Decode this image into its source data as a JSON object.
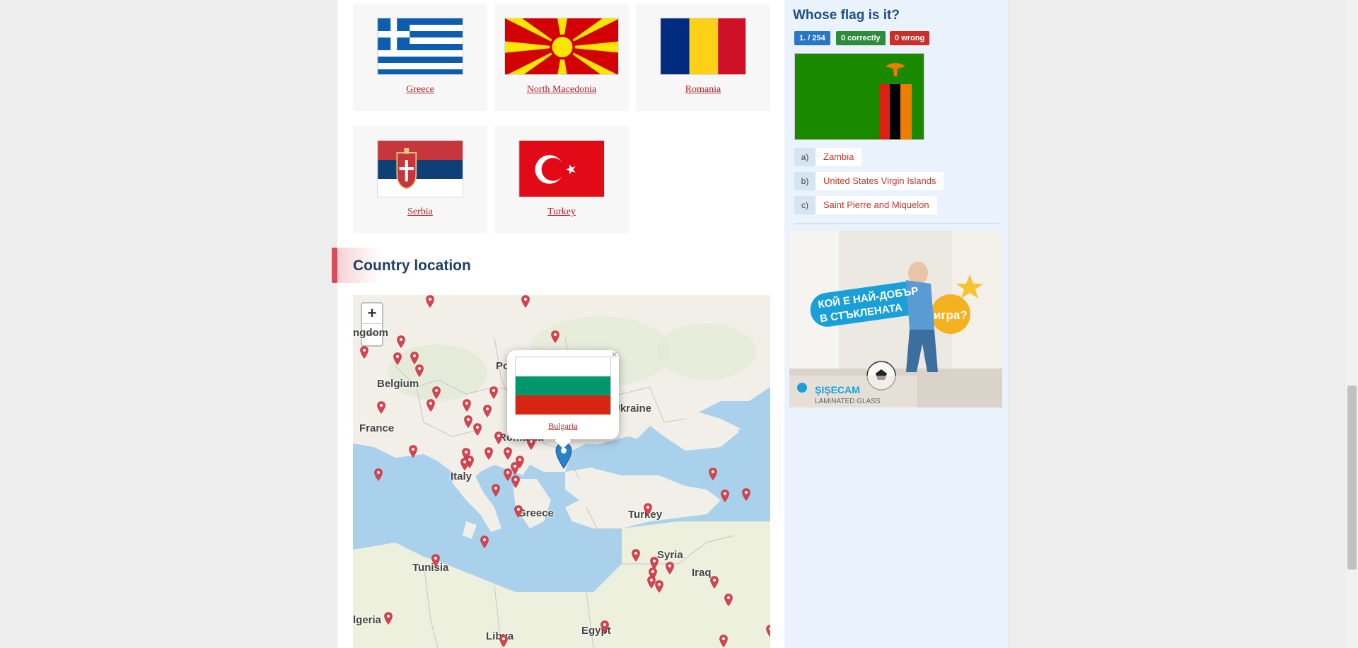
{
  "flags": [
    {
      "name": "Greece"
    },
    {
      "name": "North Macedonia"
    },
    {
      "name": "Romania"
    },
    {
      "name": "Serbia"
    },
    {
      "name": "Turkey"
    }
  ],
  "section": {
    "title": "Country location"
  },
  "map": {
    "zoom_in": "+",
    "zoom_out": "−",
    "labels": [
      "ngdom",
      "Belgium",
      "Po",
      "Ukraine",
      "France",
      "Romania",
      "Italy",
      "Greece",
      "Turkey",
      "Syria",
      "Iraq",
      "Tunisia",
      "lgeria",
      "Libya",
      "Egypt"
    ],
    "popup": {
      "country": "Bulgaria",
      "close": "×"
    }
  },
  "quiz": {
    "title": "Whose flag is it?",
    "progress": "1. / 254",
    "correct": "0  correctly",
    "wrong": "0  wrong",
    "answers": [
      {
        "letter": "a)",
        "text": "Zambia"
      },
      {
        "letter": "b)",
        "text": "United States Virgin Islands"
      },
      {
        "letter": "c)",
        "text": "Saint Pierre and Miquelon"
      }
    ]
  },
  "ad": {
    "headline_1": "КОЙ Е НАЙ-ДОБЪР",
    "headline_2": "В СТЪКЛЕНАТА",
    "headline_3": "игра?",
    "brand": "ŞIŞECAM",
    "brand_sub": "LAMINATED GLASS"
  },
  "colors": {
    "link": "#b3232d",
    "accent_title": "#1f3f63",
    "badge_blue": "#2a76c6",
    "badge_green": "#2e8b3c",
    "badge_red": "#c9302c"
  }
}
